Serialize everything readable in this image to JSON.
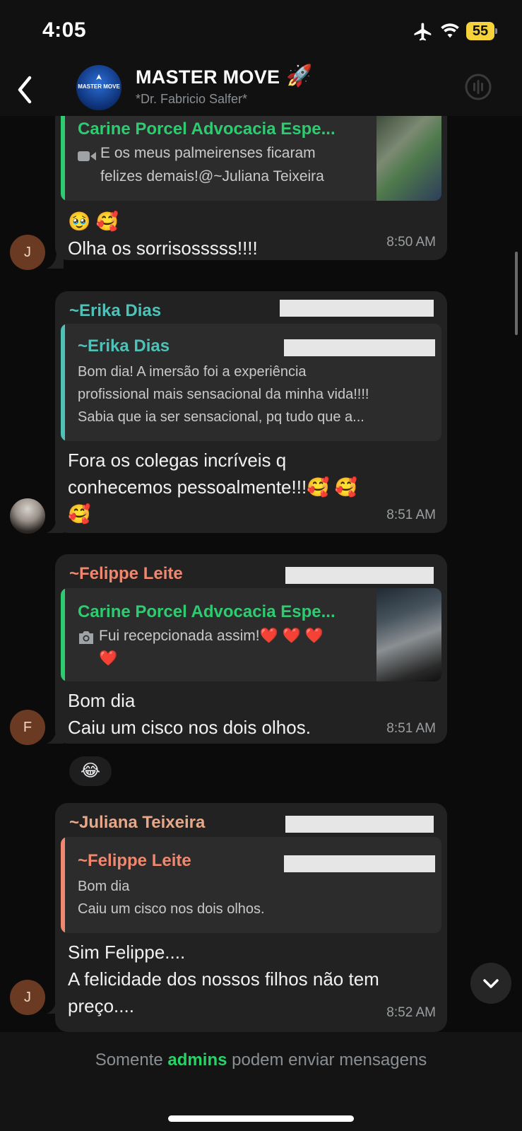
{
  "status_bar": {
    "time": "4:05",
    "battery": "55"
  },
  "header": {
    "title": "MASTER MOVE",
    "title_emoji": "🚀",
    "subtitle": "*Dr. Fabricio Salfer*",
    "avatar_text": "MASTER MOVE"
  },
  "messages": [
    {
      "quote": {
        "name": "Carine Porcel Advocacia Espe...",
        "text": "E os meus palmeirenses ficaram\nfelizes demais!@~Juliana Teixeira",
        "media_icon": "video-icon"
      },
      "text": "🥹 🥰\nOlha os sorrisosssss!!!!",
      "time": "8:50 AM",
      "avatar_letter": "J"
    },
    {
      "sender": "~Erika Dias",
      "quote": {
        "name": "~Erika Dias",
        "text": "Bom dia! A imersão foi a experiência\nprofissional mais sensacional da minha vida!!!!\nSabia que ia ser sensacional, pq tudo que a..."
      },
      "text": "Fora os colegas incríveis q\nconhecemos pessoalmente!!!🥰 🥰\n🥰",
      "time": "8:51 AM"
    },
    {
      "sender": "~Felippe Leite",
      "quote": {
        "name": "Carine Porcel Advocacia Espe...",
        "text": "Fui recepcionada assim!❤️ ❤️ ❤️\n❤️",
        "media_icon": "camera-icon"
      },
      "text": "Bom dia\nCaiu um cisco nos dois olhos.",
      "time": "8:51 AM",
      "avatar_letter": "F",
      "reaction": "😂"
    },
    {
      "sender": "~Juliana Teixeira",
      "quote": {
        "name": "~Felippe Leite",
        "text": "Bom dia\nCaiu um cisco nos dois olhos."
      },
      "text": "Sim Felippe....\nA felicidade dos nossos filhos não tem\npreço....",
      "time": "8:52 AM",
      "avatar_letter": "J"
    }
  ],
  "footer": {
    "text_before": "Somente ",
    "text_accent": "admins",
    "text_after": " podem enviar mensagens"
  },
  "colors": {
    "accent_green": "#25d366",
    "quote_green": "#2ecc71",
    "erika_teal": "#4fc2b8",
    "felippe_salmon": "#f0876f",
    "juliana_peach": "#e7a88a",
    "avatar_brown": "#6b3a22",
    "bubble": "#222222",
    "background": "#0b0b0b"
  }
}
